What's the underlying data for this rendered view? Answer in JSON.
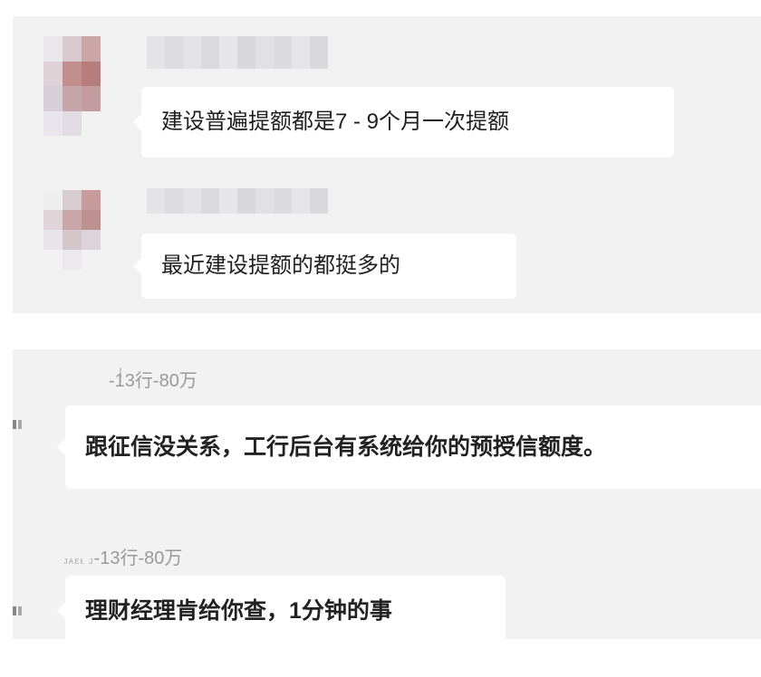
{
  "top_panel": {
    "messages": [
      {
        "text": "建设普遍提额都是7 - 9个月一次提额"
      },
      {
        "text": "最近建设提额的都挺多的"
      }
    ],
    "avatar1_colors": [
      "#e9e7ea",
      "#d9c9cc",
      "#caa6a6",
      "#f1f1f1",
      "#dfd2d6",
      "#c28f8e",
      "#b77d7d",
      "#f1f1f1",
      "#d9cfd8",
      "#c6a6a8",
      "#c49ca0",
      "#f1f1f1",
      "#e8e6ec",
      "#e2dde3",
      "#f1f1f1",
      "#f1f1f1"
    ],
    "avatar2_colors": [
      "#efeeef",
      "#d7cdd0",
      "#c79c9a",
      "#f1f1f1",
      "#dfd4d8",
      "#c9a7a8",
      "#be9190",
      "#f1f1f1",
      "#e7e5ea",
      "#d5c6cb",
      "#dcd4da",
      "#f1f1f1",
      "#f1f1f1",
      "#ebe9ec",
      "#f1f1f1",
      "#f1f1f1"
    ],
    "name_blur_colors": [
      "#e4e4e6",
      "#dcdcdf",
      "#e3e3e5",
      "#dadadd",
      "#e6e6e8",
      "#d8d8db",
      "#e1e1e3",
      "#dbdbde",
      "#e5e5e7",
      "#d9d9dc"
    ]
  },
  "bottom_panel": {
    "messages": [
      {
        "sender": "-13行-80万",
        "text": "跟征信没关系，工行后台有系统给你的预授信额度。"
      },
      {
        "sender_prefix": "ᴊᴀᴇᴌ ᴊ",
        "sender": "-13行-80万",
        "text": "理财经理肯给你查，1分钟的事"
      }
    ]
  }
}
